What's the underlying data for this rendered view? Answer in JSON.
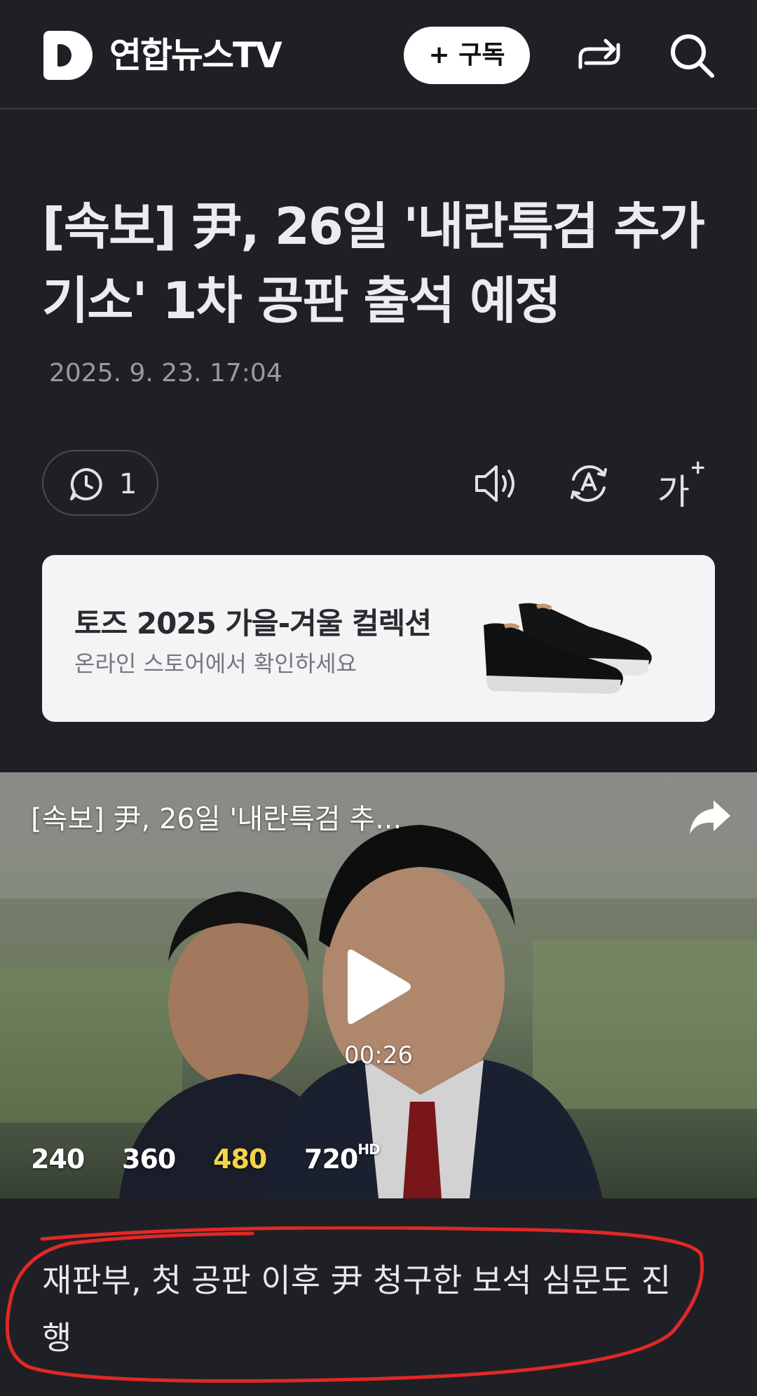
{
  "header": {
    "brand": "연합뉴스TV",
    "subscribe_label": "+ 구독",
    "icons": [
      "logo-d-icon",
      "share-arrow-icon",
      "search-icon"
    ]
  },
  "article": {
    "title_line1": "[속보] 尹, 26일 '내란특검 추가",
    "title_line2": "기소' 1차 공판 출석 예정",
    "date": "2025. 9. 23. 17:04"
  },
  "toolbar": {
    "comment_count": "1",
    "icons": [
      "comment-icon",
      "speaker-icon",
      "auto-translate-icon",
      "font-size-icon"
    ],
    "font_size_label": "가"
  },
  "ad": {
    "title": "토즈 2025 가을-겨울 컬렉션",
    "subtitle": "온라인 스토어에서 확인하세요"
  },
  "video": {
    "title": "[속보] 尹, 26일 '내란특검 추...",
    "duration": "00:26",
    "qualities": [
      "240",
      "360",
      "480",
      "720"
    ],
    "hd_badge": "HD",
    "selected_quality": "480"
  },
  "caption": {
    "line1": "재판부, 첫 공판 이후 尹 청구한 보석 심문도 진",
    "line2": "행"
  },
  "colors": {
    "background": "#1f2025",
    "accent_quality": "#f5d34a",
    "annotation_red": "#e02828"
  }
}
